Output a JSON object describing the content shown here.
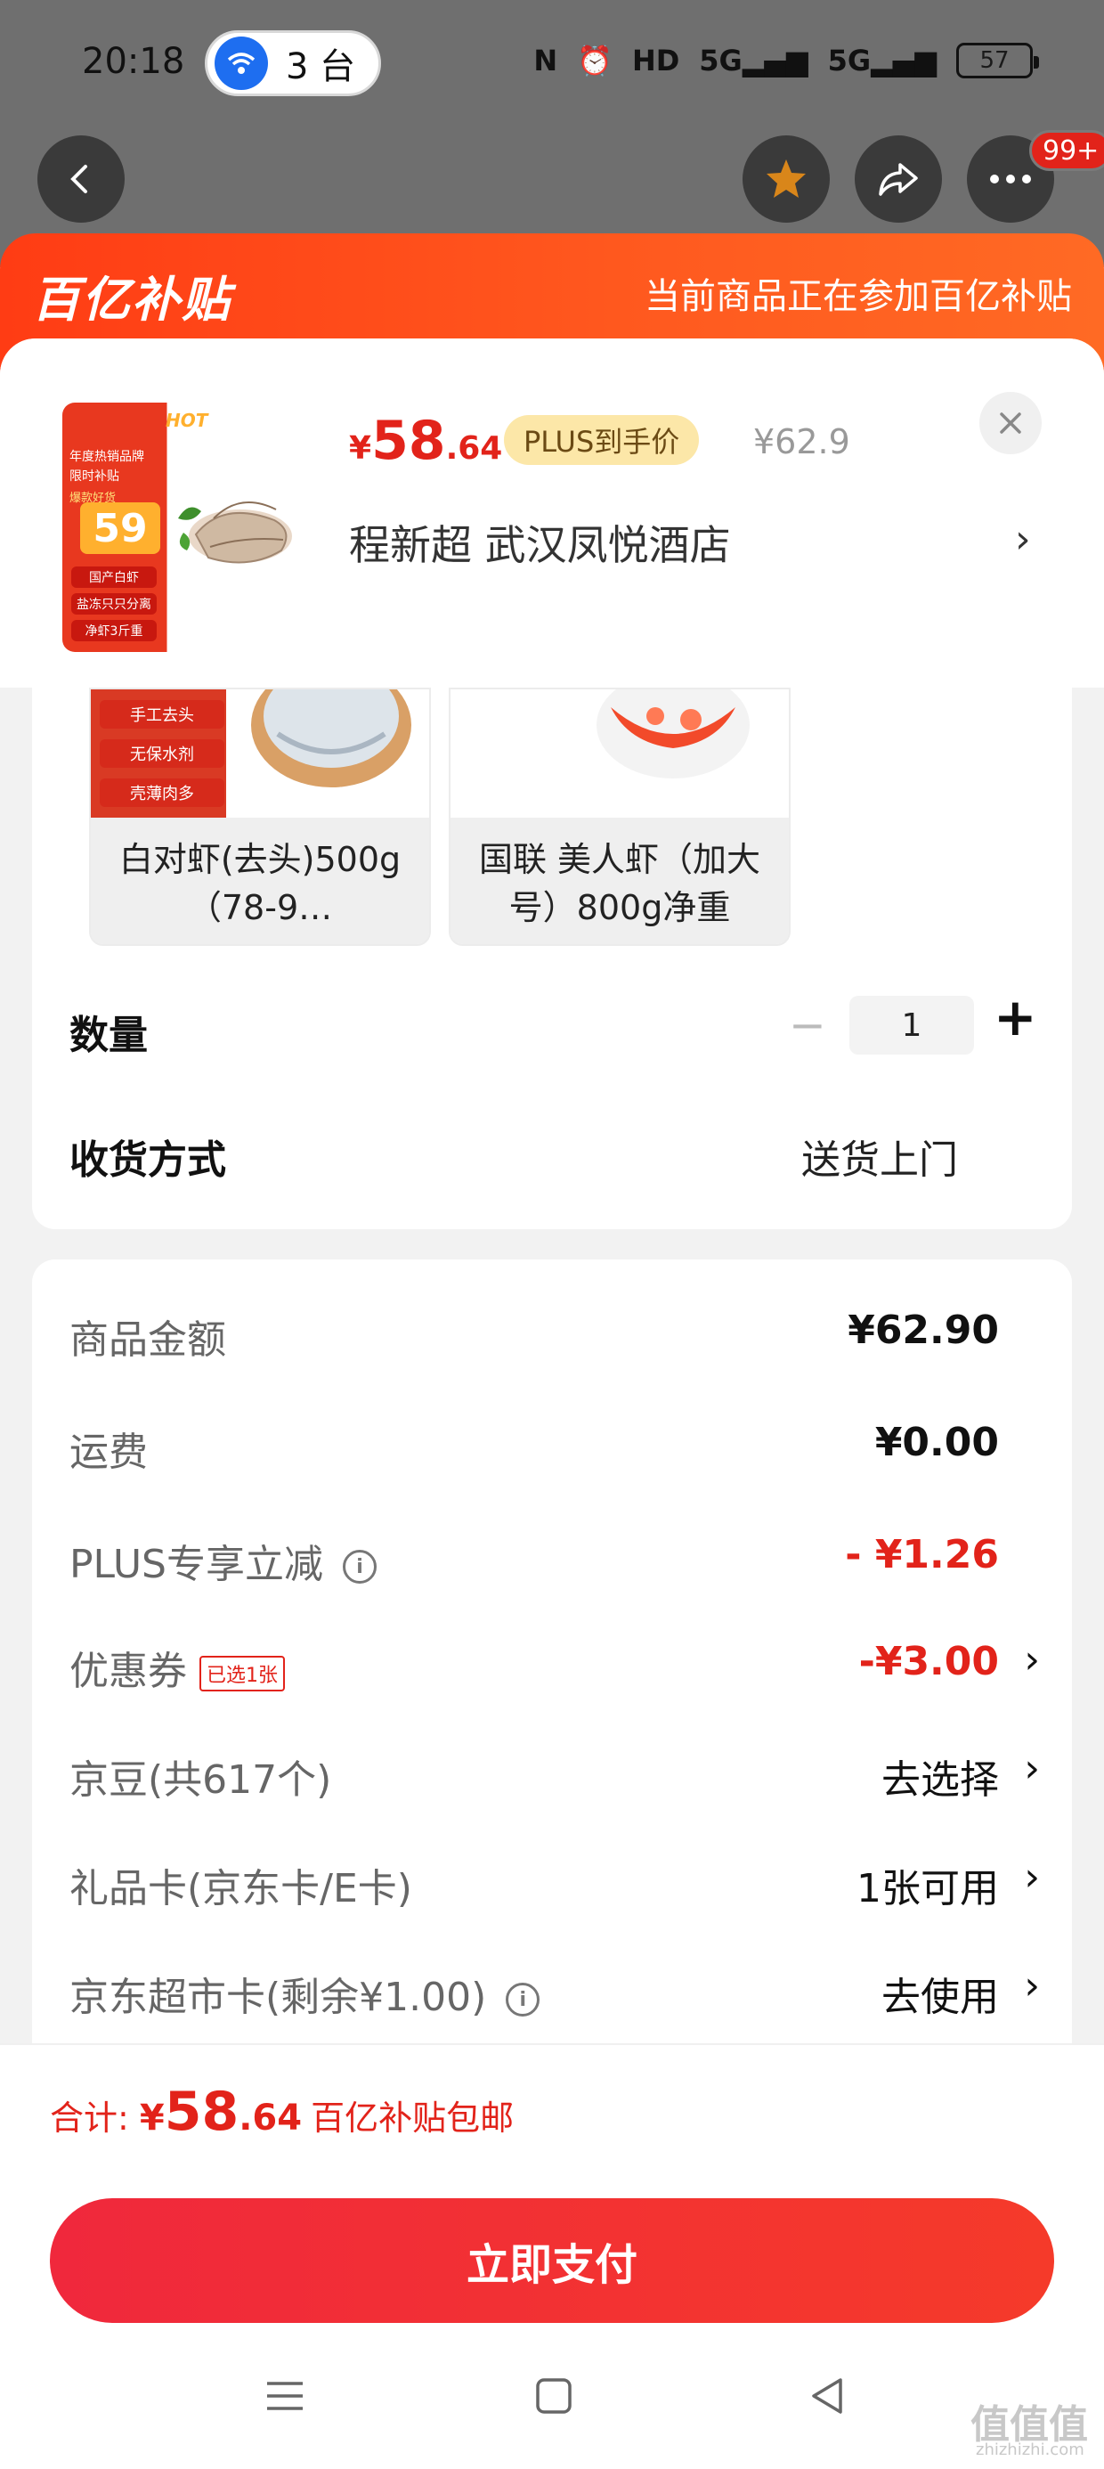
{
  "status_bar": {
    "time": "20:18",
    "wifi_devices": "3 台",
    "icons": [
      "nfc-icon",
      "alarm-icon",
      "hd-icon",
      "signal-5g-icon",
      "signal-5g-icon-2"
    ],
    "battery": "57",
    "network_5g": "5G",
    "hd": "HD"
  },
  "top_nav": {
    "notification_badge": "99+"
  },
  "banner": {
    "logo": "百亿补贴",
    "text": "当前商品正在参加百亿补贴"
  },
  "product": {
    "price_yen": "¥",
    "price_int": "58",
    "price_dec": ".64",
    "plus_tag": "PLUS到手价",
    "original_price": "¥62.9",
    "store": "程新超  武汉凤悦酒店",
    "thumb": {
      "hot": "HOT",
      "line1": "年度热销品牌",
      "line2": "限时补贴",
      "line3": "爆款好货",
      "price": "59",
      "tags": [
        "国产白虾",
        "盐冻只只分离",
        "净虾3斤重"
      ]
    }
  },
  "variants": [
    {
      "label": "白对虾(去头)500g（78-9…",
      "tags": [
        "手工去头",
        "无保水剂",
        "壳薄肉多"
      ]
    },
    {
      "label": "国联 美人虾（加大号）800g净重"
    }
  ],
  "options": {
    "quantity_label": "数量",
    "quantity_value": "1",
    "minus": "−",
    "plus": "+",
    "delivery_label": "收货方式",
    "delivery_value": "送货上门"
  },
  "summary": [
    {
      "label": "商品金额",
      "value": "¥62.90",
      "style": "bold"
    },
    {
      "label": "运费",
      "value": "¥0.00",
      "style": "bold"
    },
    {
      "label": "PLUS专享立减",
      "value": "- ¥1.26",
      "style": "red",
      "info": true
    },
    {
      "label": "优惠券",
      "tag": "已选1张",
      "value": "-¥3.00",
      "style": "red",
      "chevron": true
    },
    {
      "label": "京豆(共617个)",
      "value": "去选择",
      "chevron": true
    },
    {
      "label": "礼品卡(京东卡/E卡)",
      "value": "1张可用",
      "chevron": true
    },
    {
      "label": "京东超市卡(剩余¥1.00)",
      "value": "去使用",
      "chevron": true,
      "info": true
    }
  ],
  "footer": {
    "total_label": "合计: ",
    "total_yen": "¥",
    "total_int": "58",
    "total_dec": ".64",
    "total_note": "百亿补贴包邮",
    "pay_button": "立即支付"
  },
  "watermark": {
    "main": "值值值",
    "sub": "zhizhizhi.com"
  },
  "colors": {
    "accent_red": "#e2231a",
    "banner_orange": "#ff4a1a",
    "plus_gold": "#fce7a8"
  }
}
